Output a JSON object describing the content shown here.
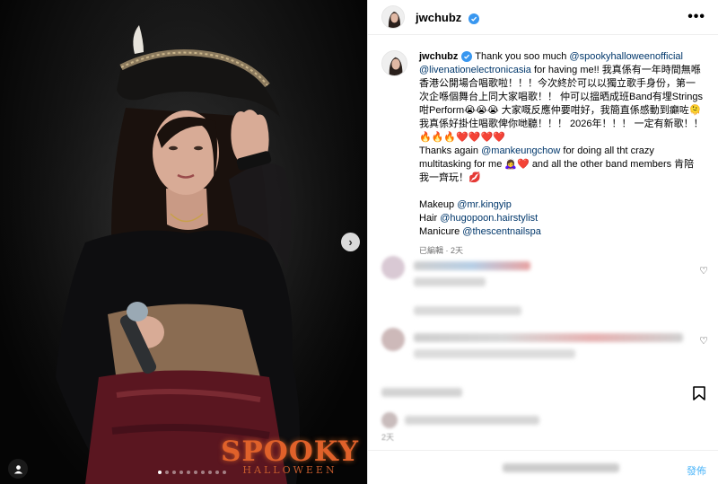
{
  "post": {
    "username": "jwchubz",
    "more_icon": "more-horizontal-icon",
    "caption": {
      "username": "jwchubz",
      "lines": [
        [
          {
            "t": "Thank you soo much "
          },
          {
            "t": "@spookyhalloweenofficial",
            "link": true
          }
        ],
        [
          {
            "t": "@livenationelectronicasia",
            "link": true
          },
          {
            "t": " for having me!! 我真係有一年時間無喺"
          }
        ],
        [
          {
            "t": "香港公開場合唱歌啦！！！今次終於可以以獨立歌手身份，第一"
          }
        ],
        [
          {
            "t": "次企喺個舞台上同大家唱歌！！ 仲可以搵晒成班Band有埋Strings"
          }
        ],
        [
          {
            "t": "咁Perform😭😭😭 大家嘅反應仲要咁好，我簡直係感動到癲咗🫠"
          }
        ],
        [
          {
            "t": "我真係好掛住唱歌俾你哋聽！！！ 2026年！！！ 一定有新歌！！"
          }
        ],
        [
          {
            "t": "🔥🔥🔥❤️❤️❤️❤️"
          }
        ],
        [
          {
            "t": "Thanks again "
          },
          {
            "t": "@mankeungchow",
            "link": true
          },
          {
            "t": " for doing all tht crazy"
          }
        ],
        [
          {
            "t": "multitasking for me 🙇‍♀️❤️ and all the other band members 肯陪"
          }
        ],
        [
          {
            "t": "我一齊玩！💋"
          }
        ],
        [
          {
            "t": ""
          }
        ],
        [
          {
            "t": "Makeup "
          },
          {
            "t": "@mr.kingyip",
            "link": true
          }
        ],
        [
          {
            "t": "Hair "
          },
          {
            "t": "@hugopoon.hairstylist",
            "link": true
          }
        ],
        [
          {
            "t": "Manicure "
          },
          {
            "t": "@thescentnailspa",
            "link": true
          }
        ]
      ],
      "edited_label": "已編輯",
      "separator": "·",
      "time_ago": "2天"
    },
    "comment_time": "2天",
    "post_label": "發佈",
    "photo": {
      "brand_main": "SPOOKY",
      "brand_sub": "HALLOWEEN"
    }
  },
  "colors": {
    "link": "#00376b",
    "verified": "#3897f0",
    "post_button": "#4cb5f9",
    "brand": "#e0612a"
  }
}
